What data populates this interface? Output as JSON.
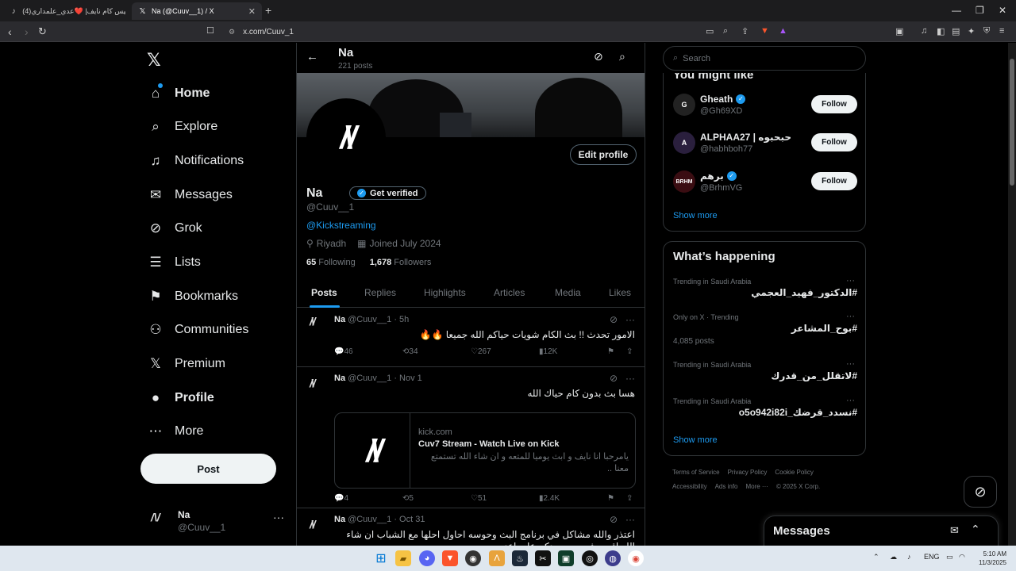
{
  "browser": {
    "tabs": [
      {
        "title": "(4)قيس كام نايف| ❤️عدي_علمداري ...",
        "icon": "tiktok-icon"
      },
      {
        "title": "Na (@Cuuv__1) / X",
        "icon": "x-icon"
      }
    ],
    "url": "x.com/Cuuv_1"
  },
  "nav": {
    "items": [
      {
        "label": "Home",
        "icon": "home-icon"
      },
      {
        "label": "Explore",
        "icon": "search-icon"
      },
      {
        "label": "Notifications",
        "icon": "bell-icon"
      },
      {
        "label": "Messages",
        "icon": "mail-icon"
      },
      {
        "label": "Grok",
        "icon": "grok-icon"
      },
      {
        "label": "Lists",
        "icon": "list-icon"
      },
      {
        "label": "Bookmarks",
        "icon": "bookmark-icon"
      },
      {
        "label": "Communities",
        "icon": "people-icon"
      },
      {
        "label": "Premium",
        "icon": "x-icon"
      },
      {
        "label": "Profile",
        "icon": "person-icon"
      },
      {
        "label": "More",
        "icon": "more-icon"
      }
    ],
    "post_label": "Post",
    "account": {
      "name": "Na",
      "handle": "@Cuuv__1"
    }
  },
  "profile": {
    "top_name": "Na",
    "top_posts": "221 posts",
    "edit_label": "Edit profile",
    "name": "Na",
    "verified_label": "Get verified",
    "handle": "@Cuuv__1",
    "link": "@Kickstreaming",
    "location": "Riyadh",
    "joined": "Joined July 2024",
    "following_count": "65",
    "following_label": "Following",
    "followers_count": "1,678",
    "followers_label": "Followers",
    "tabs": [
      "Posts",
      "Replies",
      "Highlights",
      "Articles",
      "Media",
      "Likes"
    ]
  },
  "tweets": [
    {
      "name": "Na",
      "meta": "@Cuuv__1 · 5h",
      "text": "الامور تحدث !! بث الكام شويات حياكم الله جميعا 🔥🔥",
      "replies": "46",
      "reposts": "34",
      "likes": "267",
      "views": "12K"
    },
    {
      "name": "Na",
      "meta": "@Cuuv__1 · Nov 1",
      "text": "هسا بث بدون كام حياك الله",
      "card_domain": "kick.com",
      "card_title": "Cuv7 Stream - Watch Live on Kick",
      "card_desc": "يامرحبا انا نايف و ابث يوميا للمتعه و ان شاء الله تستمتع معنا ..",
      "replies": "4",
      "reposts": "5",
      "likes": "51",
      "views": "2.4K"
    },
    {
      "name": "Na",
      "meta": "@Cuuv__1 · Oct 31",
      "text": "اعتذر والله مشاكل في برنامج البث وحوسه احاول احلها مع الشباب ان شاء الله اقرب فرصه وجودكم على اعز من"
    }
  ],
  "sidebar": {
    "search_placeholder": "Search",
    "might_like_title": "You might like",
    "suggestions": [
      {
        "name": "Gheath",
        "handle": "@Gh69XD",
        "verified": true,
        "avatar": "G"
      },
      {
        "name": "ALPHAA27 | حبحبوه",
        "handle": "@habhboh77",
        "verified": false,
        "avatar": "A"
      },
      {
        "name": "برهم",
        "handle": "@BrhmVG",
        "verified": true,
        "avatar": "BRHM"
      }
    ],
    "follow_label": "Follow",
    "show_more": "Show more",
    "happening_title": "What’s happening",
    "trends": [
      {
        "context": "Trending in Saudi Arabia",
        "title": "#الدكتور_فهيد_العجمي",
        "count": ""
      },
      {
        "context": "Only on X · Trending",
        "title": "#بوح_المشاعر",
        "count": "4,085 posts"
      },
      {
        "context": "Trending in Saudi Arabia",
        "title": "#لاتقلل_من_قدرك",
        "count": ""
      },
      {
        "context": "Trending in Saudi Arabia",
        "title": "#نسدد_قرضك_o5o942i82i",
        "count": ""
      }
    ],
    "footer_row1": [
      "Terms of Service",
      "Privacy Policy",
      "Cookie Policy"
    ],
    "footer_row2": [
      "Accessibility",
      "Ads info",
      "More ···",
      "© 2025 X Corp."
    ],
    "messages_title": "Messages"
  },
  "taskbar": {
    "time": "5:10 AM",
    "date": "11/3/2025",
    "lang": "ENG"
  },
  "colors": {
    "accent": "#1d9bf0",
    "bg": "#000000",
    "border": "#2f3336",
    "muted": "#71767b"
  }
}
